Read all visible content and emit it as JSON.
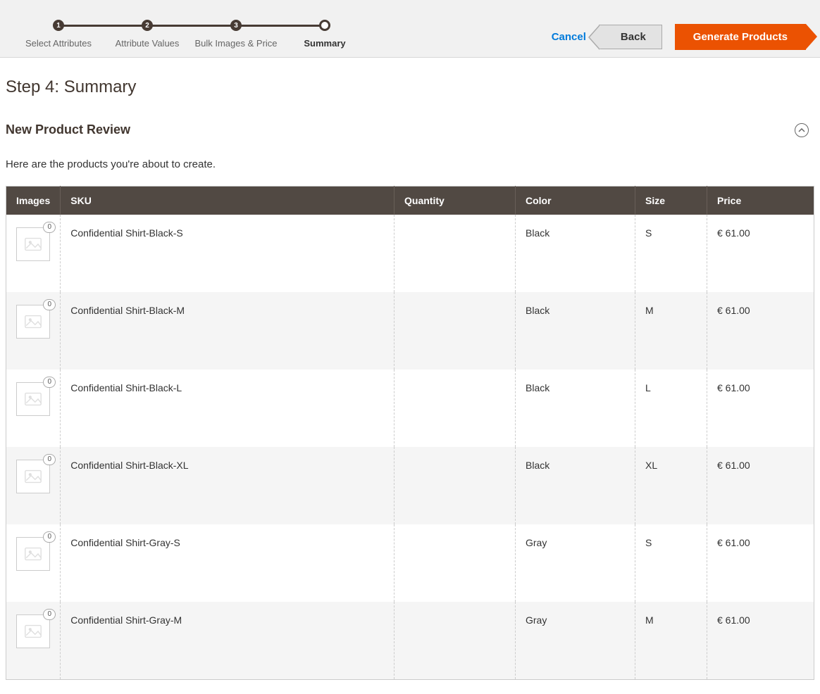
{
  "wizard": {
    "steps": [
      {
        "num": "1",
        "label": "Select Attributes"
      },
      {
        "num": "2",
        "label": "Attribute Values"
      },
      {
        "num": "3",
        "label": "Bulk Images & Price"
      },
      {
        "num": "",
        "label": "Summary"
      }
    ],
    "active_index": 3
  },
  "actions": {
    "cancel": "Cancel",
    "back": "Back",
    "generate": "Generate Products"
  },
  "page_title": "Step 4: Summary",
  "section": {
    "title": "New Product Review",
    "subtitle": "Here are the products you're about to create."
  },
  "table": {
    "columns": [
      "Images",
      "SKU",
      "Quantity",
      "Color",
      "Size",
      "Price"
    ],
    "rows": [
      {
        "badge": "0",
        "sku": "Confidential Shirt-Black-S",
        "qty": "",
        "color": "Black",
        "size": "S",
        "price": "€ 61.00"
      },
      {
        "badge": "0",
        "sku": "Confidential Shirt-Black-M",
        "qty": "",
        "color": "Black",
        "size": "M",
        "price": "€ 61.00"
      },
      {
        "badge": "0",
        "sku": "Confidential Shirt-Black-L",
        "qty": "",
        "color": "Black",
        "size": "L",
        "price": "€ 61.00"
      },
      {
        "badge": "0",
        "sku": "Confidential Shirt-Black-XL",
        "qty": "",
        "color": "Black",
        "size": "XL",
        "price": "€ 61.00"
      },
      {
        "badge": "0",
        "sku": "Confidential Shirt-Gray-S",
        "qty": "",
        "color": "Gray",
        "size": "S",
        "price": "€ 61.00"
      },
      {
        "badge": "0",
        "sku": "Confidential Shirt-Gray-M",
        "qty": "",
        "color": "Gray",
        "size": "M",
        "price": "€ 61.00"
      }
    ]
  }
}
